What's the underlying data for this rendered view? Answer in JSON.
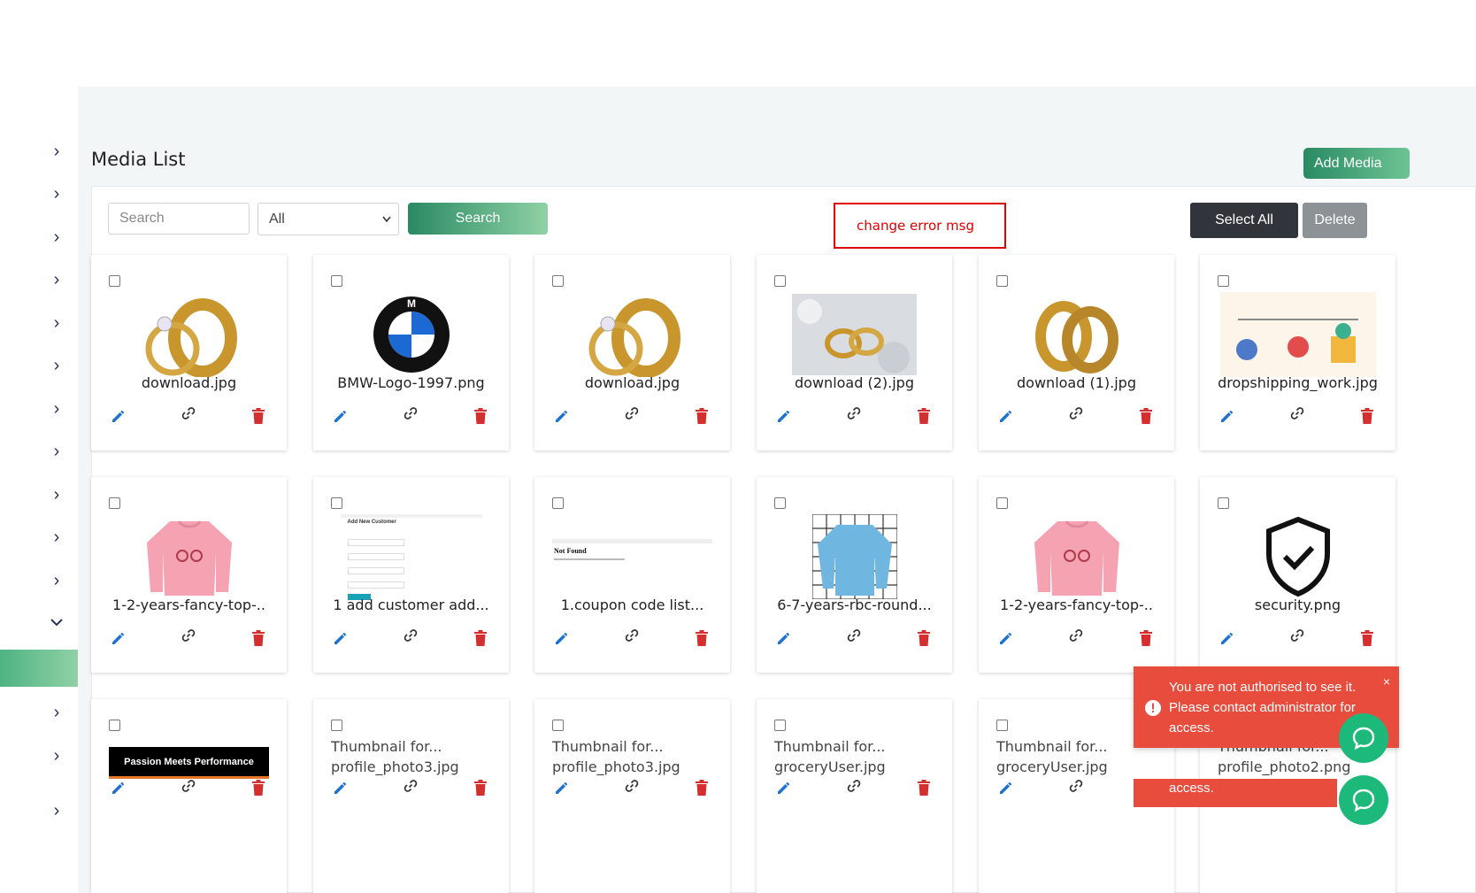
{
  "page": {
    "title": "Media List"
  },
  "header": {
    "add_media_label": "Add Media"
  },
  "toolbar": {
    "search_placeholder": "Search",
    "filter_value": "All",
    "search_button": "Search",
    "error_note": "change error msg",
    "select_all_button": "Select All",
    "delete_button": "Delete"
  },
  "media": [
    {
      "name": "download.jpg",
      "thumb": "rings"
    },
    {
      "name": "BMW-Logo-1997.png",
      "thumb": "bmw-logo"
    },
    {
      "name": "download.jpg",
      "thumb": "rings"
    },
    {
      "name": "download (2).jpg",
      "thumb": "rings-photo"
    },
    {
      "name": "download (1).jpg",
      "thumb": "rings-pair"
    },
    {
      "name": "dropshipping_work.jpg",
      "thumb": "infographic"
    },
    {
      "name": "1-2-years-fancy-top-..",
      "thumb": "pink-sweatshirt"
    },
    {
      "name": "1 add customer add...",
      "thumb": "form-screenshot"
    },
    {
      "name": "1.coupon code list...",
      "thumb": "not-found-screenshot"
    },
    {
      "name": "6-7-years-rbc-round...",
      "thumb": "blue-sweatshirt"
    },
    {
      "name": "1-2-years-fancy-top-..",
      "thumb": "pink-sweatshirt"
    },
    {
      "name": "security.png",
      "thumb": "shield-check"
    },
    {
      "name": "",
      "thumb": "banner",
      "banner_text": "Passion Meets Performance"
    },
    {
      "alt": "Thumbnail for...",
      "name": "profile_photo3.jpg"
    },
    {
      "alt": "Thumbnail for...",
      "name": "profile_photo3.jpg"
    },
    {
      "alt": "Thumbnail for...",
      "name": "groceryUser.jpg"
    },
    {
      "alt": "Thumbnail for...",
      "name": "groceryUser.jpg"
    },
    {
      "alt": "Thumbnail for...",
      "name": "profile_photo2.png"
    }
  ],
  "thumb_texts": {
    "form_title": "Add New Customer",
    "not_found": "Not Found"
  },
  "toast": {
    "message": "You are not authorised to see it. Please contact administrator for access.",
    "close": "×",
    "second_message": "access."
  },
  "colors": {
    "accent": "#2a8a63",
    "danger": "#d32f2f",
    "edit": "#1e73d2",
    "toast": "#e74c3c"
  }
}
